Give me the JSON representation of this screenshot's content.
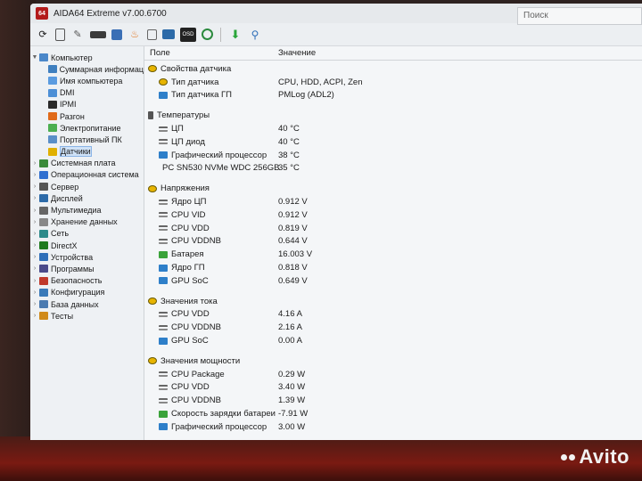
{
  "window": {
    "title": "AIDA64 Extreme v7.00.6700",
    "app_badge": "64"
  },
  "search": {
    "placeholder": "Поиск"
  },
  "toolbar": {
    "icons": [
      "refresh-icon",
      "report-icon",
      "pencil-icon",
      "motherboard-icon",
      "memory-icon",
      "flame-icon",
      "copy-icon",
      "monitor-icon",
      "osd-icon",
      "gauge-icon",
      "download-icon",
      "search-icon"
    ]
  },
  "grid": {
    "col_field": "Поле",
    "col_value": "Значение"
  },
  "tree": {
    "computer": "Компьютер",
    "children": [
      "Суммарная информац",
      "Имя компьютера",
      "DMI",
      "IPMI",
      "Разгон",
      "Электропитание",
      "Портативный ПК",
      "Датчики"
    ],
    "top": [
      "Системная плата",
      "Операционная система",
      "Сервер",
      "Дисплей",
      "Мультимедиа",
      "Хранение данных",
      "Сеть",
      "DirectX",
      "Устройства",
      "Программы",
      "Безопасность",
      "Конфигурация",
      "База данных",
      "Тесты"
    ]
  },
  "sections": {
    "sensor_props": {
      "title": "Свойства датчика",
      "rows": [
        {
          "name": "Тип датчика",
          "value": "CPU, HDD, ACPI, Zen"
        },
        {
          "name": "Тип датчика ГП",
          "value": "PMLog  (ADL2)"
        }
      ]
    },
    "temps": {
      "title": "Температуры",
      "rows": [
        {
          "name": "ЦП",
          "value": "40 °C"
        },
        {
          "name": "ЦП диод",
          "value": "40 °C"
        },
        {
          "name": "Графический процессор",
          "value": "38 °C"
        },
        {
          "name": "PC SN530 NVMe WDC 256GB",
          "value": "35 °C"
        }
      ]
    },
    "volts": {
      "title": "Напряжения",
      "rows": [
        {
          "name": "Ядро ЦП",
          "value": "0.912 V"
        },
        {
          "name": "CPU VID",
          "value": "0.912 V"
        },
        {
          "name": "CPU VDD",
          "value": "0.819 V"
        },
        {
          "name": "CPU VDDNB",
          "value": "0.644 V"
        },
        {
          "name": "Батарея",
          "value": "16.003 V"
        },
        {
          "name": "Ядро ГП",
          "value": "0.818 V"
        },
        {
          "name": "GPU SoC",
          "value": "0.649 V"
        }
      ]
    },
    "currents": {
      "title": "Значения тока",
      "rows": [
        {
          "name": "CPU VDD",
          "value": "4.16 A"
        },
        {
          "name": "CPU VDDNB",
          "value": "2.16 A"
        },
        {
          "name": "GPU SoC",
          "value": "0.00 A"
        }
      ]
    },
    "power": {
      "title": "Значения мощности",
      "rows": [
        {
          "name": "CPU Package",
          "value": "0.29 W"
        },
        {
          "name": "CPU VDD",
          "value": "3.40 W"
        },
        {
          "name": "CPU VDDNB",
          "value": "1.39 W"
        },
        {
          "name": "Скорость зарядки батареи",
          "value": "-7.91 W"
        },
        {
          "name": "Графический процессор",
          "value": "3.00 W"
        }
      ]
    }
  },
  "watermark": "Avito"
}
